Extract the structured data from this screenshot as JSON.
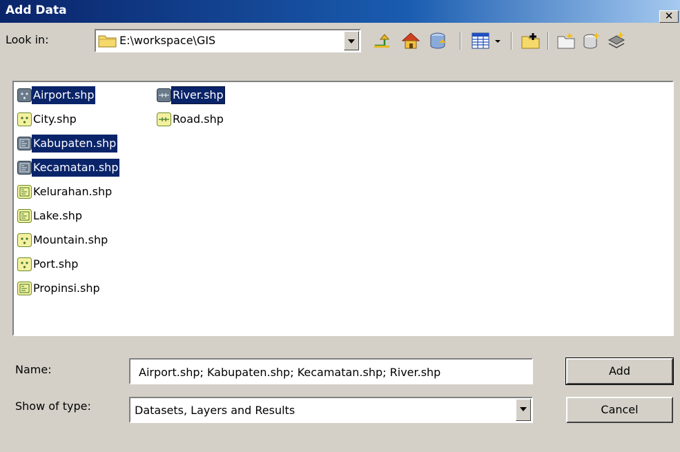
{
  "window": {
    "title": "Add Data",
    "close_label": "✕"
  },
  "look_in": {
    "label": "Look in:",
    "path": "E:\\workspace\\GIS"
  },
  "toolbar": [
    "up-one-level-icon",
    "home-icon",
    "catalog-icon",
    "views-icon",
    "connect-folder-icon",
    "new-folder-icon",
    "new-geodatabase-icon",
    "new-layer-icon"
  ],
  "files": [
    {
      "name": "Airport.shp",
      "type": "point",
      "selected": true
    },
    {
      "name": "City.shp",
      "type": "point",
      "selected": false
    },
    {
      "name": "Kabupaten.shp",
      "type": "polygon",
      "selected": true
    },
    {
      "name": "Kecamatan.shp",
      "type": "polygon",
      "selected": true
    },
    {
      "name": "Kelurahan.shp",
      "type": "polygon",
      "selected": false
    },
    {
      "name": "Lake.shp",
      "type": "polygon",
      "selected": false
    },
    {
      "name": "Mountain.shp",
      "type": "point",
      "selected": false
    },
    {
      "name": "Port.shp",
      "type": "point",
      "selected": false
    },
    {
      "name": "Propinsi.shp",
      "type": "polygon",
      "selected": false
    },
    {
      "name": "River.shp",
      "type": "line",
      "selected": true
    },
    {
      "name": "Road.shp",
      "type": "line",
      "selected": false
    }
  ],
  "name_field": {
    "label": "Name:",
    "value": "Airport.shp; Kabupaten.shp; Kecamatan.shp; River.shp"
  },
  "type_field": {
    "label": "Show of type:",
    "value": "Datasets, Layers and Results"
  },
  "buttons": {
    "add": "Add",
    "cancel": "Cancel"
  },
  "colors": {
    "selection": "#0a246a",
    "titlebar": "#0a246a",
    "dialog_bg": "#d4d0c8"
  }
}
